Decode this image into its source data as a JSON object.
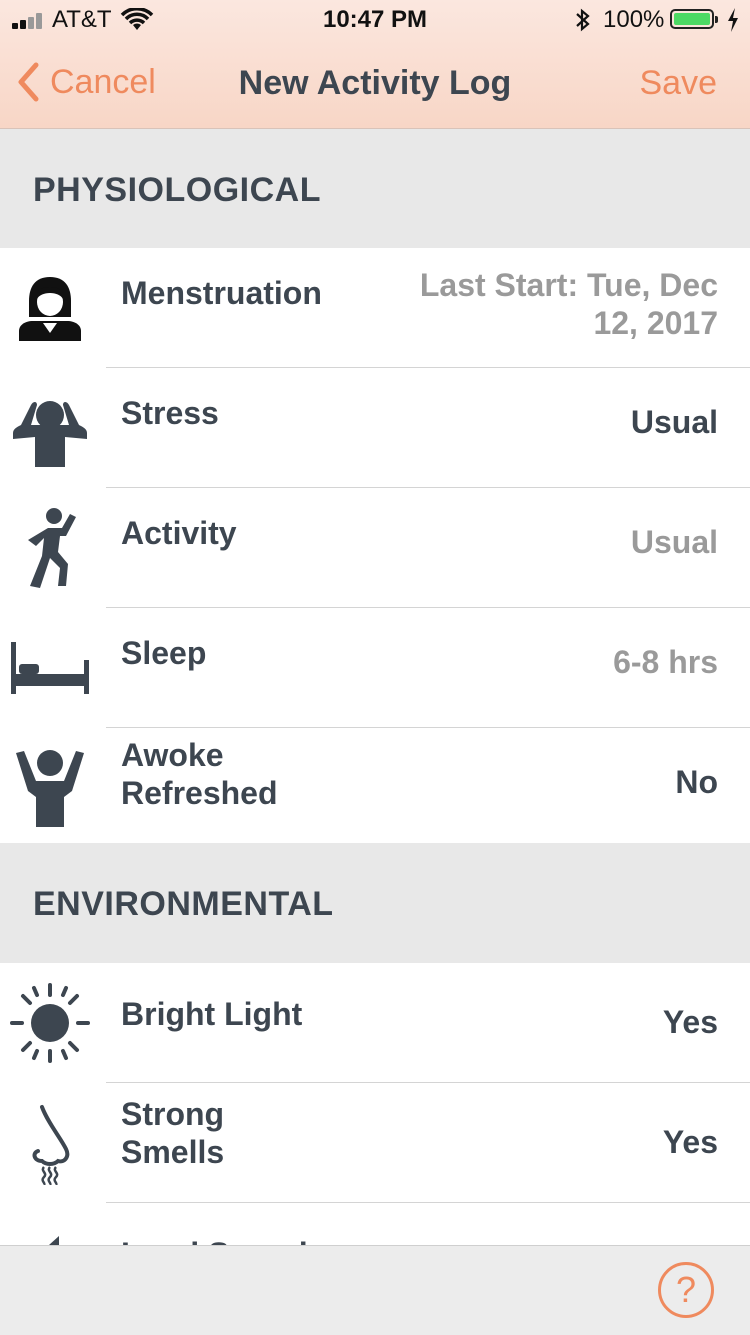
{
  "status_bar": {
    "carrier": "AT&T",
    "time": "10:47 PM",
    "battery": "100%"
  },
  "nav": {
    "cancel_label": "Cancel",
    "title": "New Activity Log",
    "save_label": "Save"
  },
  "sections": {
    "physiological": {
      "title": "PHYSIOLOGICAL",
      "rows": [
        {
          "icon": "woman-icon",
          "label": "Menstruation",
          "value_line1": "Last Start: Tue, Dec",
          "value_line2": "12, 2017"
        },
        {
          "icon": "stressed-person-icon",
          "label": "Stress",
          "value": "Usual"
        },
        {
          "icon": "running-person-icon",
          "label": "Activity",
          "value": "Usual"
        },
        {
          "icon": "bed-icon",
          "label": "Sleep",
          "value": "6-8 hrs"
        },
        {
          "icon": "arms-raised-person-icon",
          "label_line1": "Awoke",
          "label_line2": "Refreshed",
          "value": "No"
        }
      ]
    },
    "environmental": {
      "title": "ENVIRONMENTAL",
      "rows": [
        {
          "icon": "sun-icon",
          "label": "Bright Light",
          "value": "Yes"
        },
        {
          "icon": "nose-icon",
          "label_line1": "Strong",
          "label_line2": "Smells",
          "value": "Yes"
        },
        {
          "icon": "speaker-icon",
          "label": "Loud Sounds"
        }
      ]
    }
  },
  "colors": {
    "accent": "#ef8a5e",
    "text": "#3d4650",
    "muted": "#9a9a9a",
    "section_bg": "#e8e8e8"
  }
}
